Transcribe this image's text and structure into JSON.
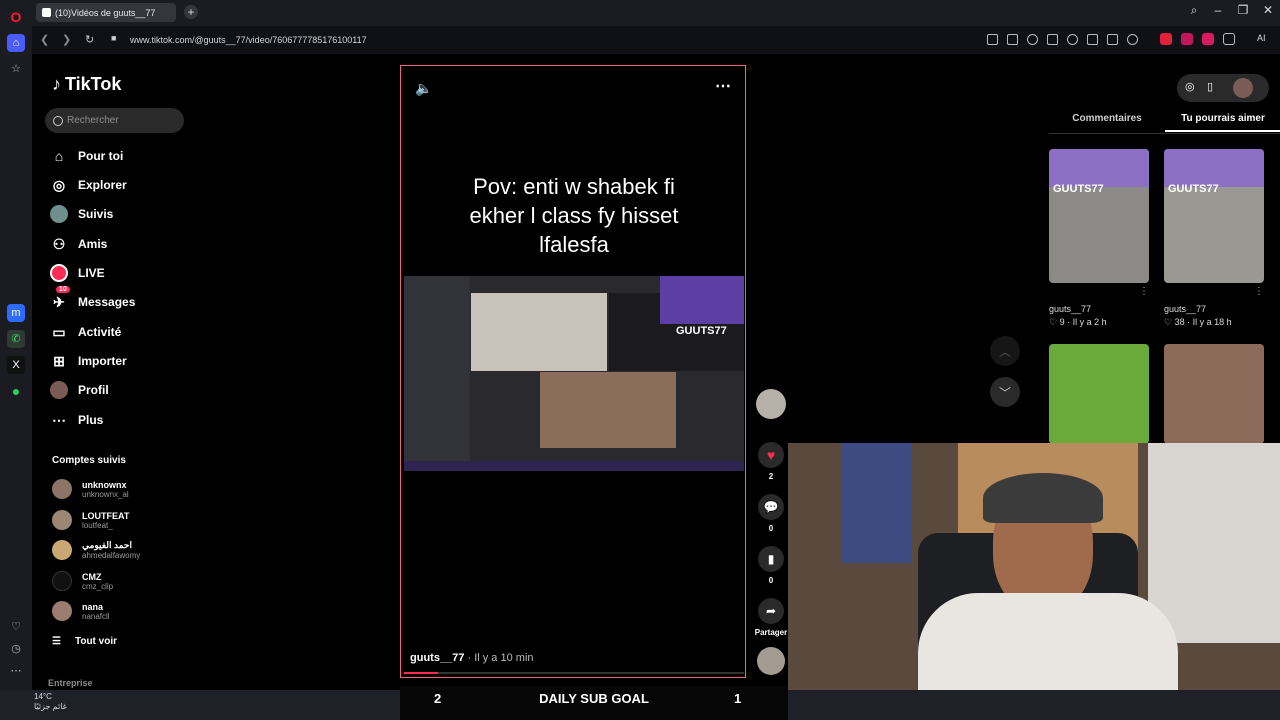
{
  "browser": {
    "tab_title": "(10)Vidéos de guuts__77",
    "new_tab": "+",
    "url": "www.tiktok.com/@guuts__77/video/7606777785176100117",
    "ai_label": "AI"
  },
  "sidebar": {
    "logo": "TikTok",
    "search_placeholder": "Rechercher",
    "nav": [
      {
        "label": "Pour toi",
        "icon": "home-icon"
      },
      {
        "label": "Explorer",
        "icon": "compass-icon"
      },
      {
        "label": "Suivis",
        "icon": "following-icon"
      },
      {
        "label": "Amis",
        "icon": "friends-icon"
      },
      {
        "label": "LIVE",
        "icon": "live-icon"
      },
      {
        "label": "Messages",
        "icon": "message-icon",
        "badge": "10"
      },
      {
        "label": "Activité",
        "icon": "activity-icon"
      },
      {
        "label": "Importer",
        "icon": "upload-icon"
      },
      {
        "label": "Profil",
        "icon": "profile-icon"
      },
      {
        "label": "Plus",
        "icon": "more-icon"
      }
    ],
    "followed_title": "Comptes suivis",
    "followed": [
      {
        "name": "unknownx",
        "handle": "unknownx_al"
      },
      {
        "name": "LOUTFEAT",
        "handle": "loutfeat_"
      },
      {
        "name": "احمد الفيومي",
        "handle": "ahmedalfawomy"
      },
      {
        "name": "CMZ",
        "handle": "cmz_clip"
      },
      {
        "name": "nana",
        "handle": "nanafcll"
      }
    ],
    "see_all": "Tout voir",
    "footer": "Entreprise"
  },
  "video": {
    "caption_line1": "Pov: enti w shabek fi",
    "caption_line2": "ekher l class fy hisset",
    "caption_line3": "lfalesfa",
    "author": "guuts__77",
    "time": " · Il y a 10 min",
    "progress_fraction": 0.1,
    "overlay_text": "GUUTS77"
  },
  "actions": {
    "likes": "2",
    "comments": "0",
    "saves": "0",
    "share_label": "Partager"
  },
  "right_panel": {
    "tab_comments": "Commentaires",
    "tab_suggest": "Tu pourrais aimer",
    "items": [
      {
        "author": "guuts__77",
        "stats": "♡ 9 · Il y a 2 h",
        "overlay": "GUUTS77"
      },
      {
        "author": "guuts__77",
        "stats": "♡ 38 · Il y a 18 h",
        "overlay": "GUUTS77"
      }
    ]
  },
  "stream_overlay": {
    "goal_current": "2",
    "goal_label": "DAILY SUB GOAL",
    "goal_target": "1"
  },
  "taskbar": {
    "temperature": "14°C",
    "weather_text": "غائم جزئيًا"
  },
  "colors": {
    "accent": "#fe2c55",
    "video_border": "#e86a7c",
    "background": "#000000"
  }
}
